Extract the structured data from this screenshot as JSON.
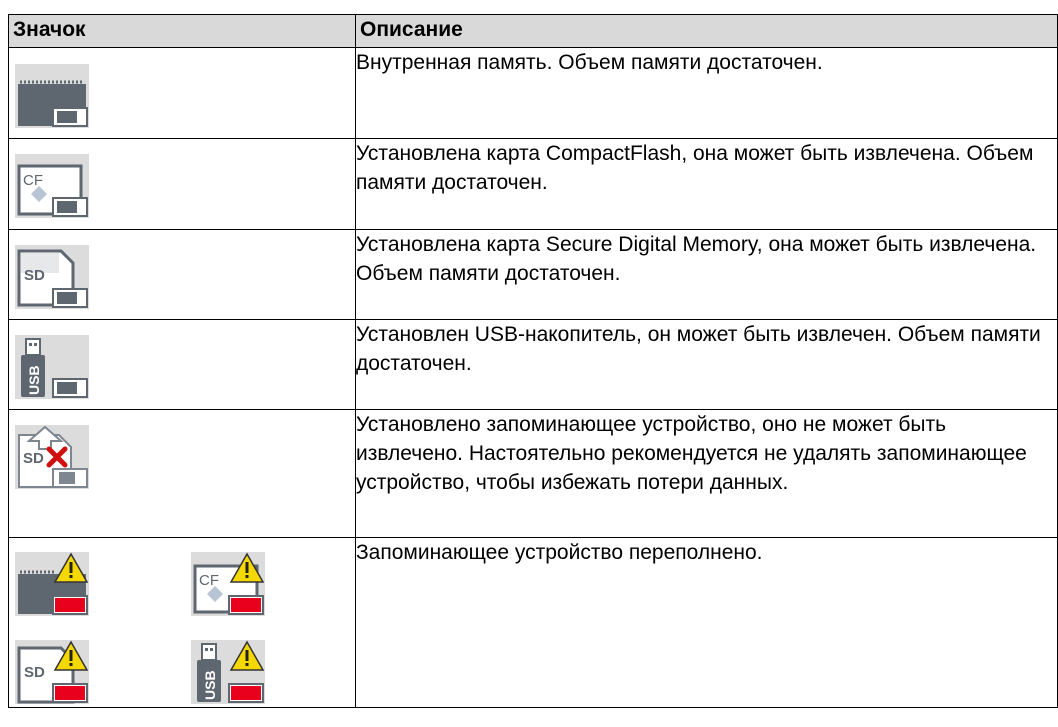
{
  "table": {
    "headers": {
      "icon": "Значок",
      "description": "Описание"
    },
    "rows": [
      {
        "icons": [
          "internal-memory-icon"
        ],
        "description": "Внутренная память. Объем памяти достаточен."
      },
      {
        "icons": [
          "compactflash-card-icon"
        ],
        "description": "Установлена карта CompactFlash, она может быть извлечена. Объем памяти достаточен.",
        "icon_text": "CF"
      },
      {
        "icons": [
          "sd-card-icon"
        ],
        "description": "Установлена карта Secure Digital Memory, она может быть извлечена. Объем памяти достаточен.",
        "icon_text": "SD"
      },
      {
        "icons": [
          "usb-stick-icon"
        ],
        "description": "Установлен USB-накопитель, он может быть извлечен. Объем памяти достаточен.",
        "icon_text": "USB"
      },
      {
        "icons": [
          "sd-card-not-removable-icon"
        ],
        "description": "Установлено запоминающее устройство, оно не может быть извлечено. Настоятельно рекомендуется не удалять запоминающее устройство, чтобы избежать потери данных.",
        "icon_text": "SD"
      },
      {
        "icons": [
          "internal-memory-full-icon",
          "compactflash-full-icon",
          "sd-card-full-icon",
          "usb-stick-full-icon"
        ],
        "description": "Запоминающее устройство переполнено.",
        "icon_texts": [
          "CF",
          "SD",
          "USB"
        ]
      }
    ]
  },
  "colors": {
    "header_bg": "#d9d9d9",
    "icon_bg": "#dcdcdc",
    "device_dark": "#5e6670",
    "full_red": "#e8001c",
    "warning_yellow": "#f5d800",
    "error_red": "#d01010"
  }
}
